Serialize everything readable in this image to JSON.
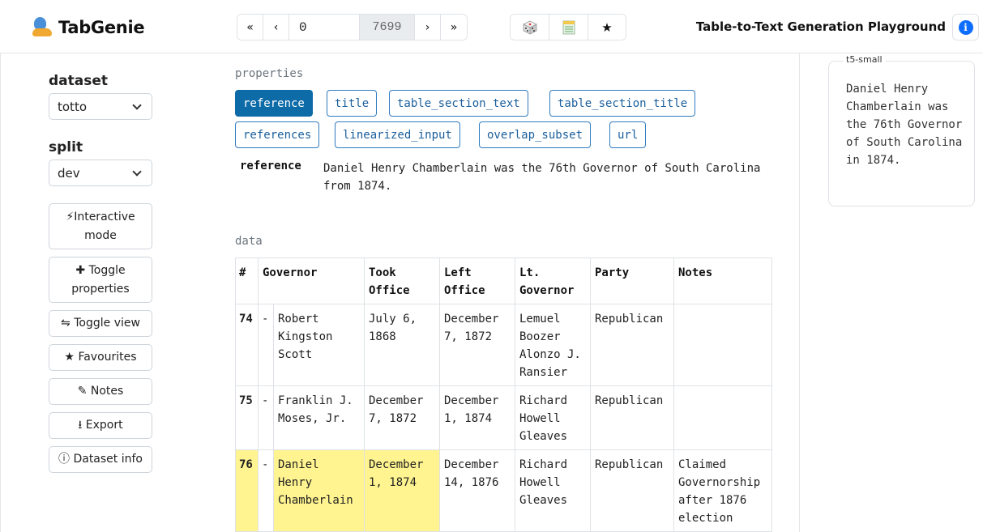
{
  "header": {
    "logo_text": "TabGenie",
    "pager": {
      "first": "«",
      "prev": "‹",
      "index_value": "0",
      "total": "7699",
      "next": "›",
      "last": "»"
    },
    "tools": {
      "random_icon": "dice-icon",
      "table_icon": "spreadsheet-icon",
      "favourite_glyph": "★"
    },
    "title": "Table-to-Text Generation Playground",
    "info_glyph": "i"
  },
  "sidebar": {
    "dataset_label": "dataset",
    "dataset_value": "totto",
    "split_label": "split",
    "split_value": "dev",
    "buttons": [
      {
        "icon": "⚡",
        "label": "Interactive mode"
      },
      {
        "icon": "✚",
        "label": "Toggle properties"
      },
      {
        "icon": "⇋",
        "label": "Toggle view"
      },
      {
        "icon": "★",
        "label": "Favourites"
      },
      {
        "icon": "✎",
        "label": "Notes"
      },
      {
        "icon": "⭳",
        "label": "Export"
      },
      {
        "icon": "ⓘ",
        "label": "Dataset info"
      }
    ]
  },
  "properties": {
    "label": "properties",
    "tags": [
      "reference",
      "title",
      "table_section_text",
      "table_section_title",
      "references",
      "linearized_input",
      "overlap_subset",
      "url"
    ],
    "active": "reference",
    "ref_key": "reference",
    "ref_value": "Daniel Henry Chamberlain was the 76th Governor of South Carolina from 1874."
  },
  "data": {
    "label": "data",
    "headers": [
      "#",
      "Governor",
      "Took Office",
      "Left Office",
      "Lt. Governor",
      "Party",
      "Notes"
    ],
    "rows": [
      {
        "num": "74",
        "dash": "-",
        "governor": "Robert Kingston Scott",
        "took": "July 6, 1868",
        "left": "December 7, 1872",
        "lt": "Lemuel Boozer Alonzo J. Ransier",
        "party": "Republican",
        "notes": ""
      },
      {
        "num": "75",
        "dash": "-",
        "governor": "Franklin J. Moses, Jr.",
        "took": "December 7, 1872",
        "left": "December 1, 1874",
        "lt": "Richard Howell Gleaves",
        "party": "Republican",
        "notes": ""
      },
      {
        "num": "76",
        "dash": "-",
        "governor": "Daniel Henry Chamberlain",
        "took": "December 1, 1874",
        "left": "December 14, 1876",
        "lt": "Richard Howell Gleaves",
        "party": "Republican",
        "notes": "Claimed Governorship after 1876 election"
      }
    ]
  },
  "output": {
    "model": "t5-small",
    "text": "Daniel Henry Chamberlain was the 76th Governor of South Carolina in 1874."
  },
  "colors": {
    "accent": "#0d6ba8",
    "highlight": "#fff48f",
    "info": "#0d6efd"
  }
}
